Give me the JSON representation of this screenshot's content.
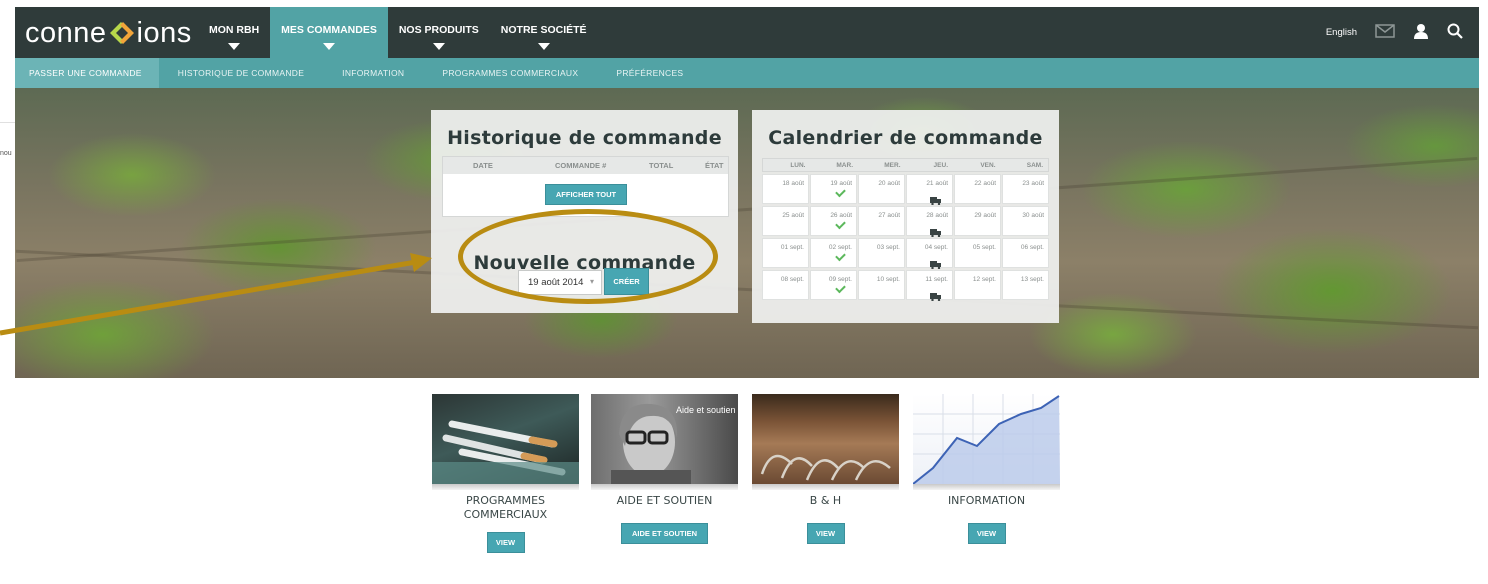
{
  "brand": {
    "logo_left": "conne",
    "logo_right": "ions",
    "logo_mark": "X"
  },
  "nav": {
    "items": [
      {
        "label": "MON RBH",
        "active": false
      },
      {
        "label": "MES COMMANDES",
        "active": true
      },
      {
        "label": "NOS PRODUITS",
        "active": false
      },
      {
        "label": "NOTRE SOCIÉTÉ",
        "active": false
      }
    ],
    "lang": "English",
    "icons": [
      "mail-icon",
      "user-icon",
      "search-icon"
    ]
  },
  "subnav": {
    "items": [
      {
        "label": "PASSER UNE COMMANDE",
        "active": true
      },
      {
        "label": "HISTORIQUE DE COMMANDE",
        "active": false
      },
      {
        "label": "INFORMATION",
        "active": false
      },
      {
        "label": "PROGRAMMES COMMERCIAUX",
        "active": false
      },
      {
        "label": "PRÉFÉRENCES",
        "active": false
      }
    ]
  },
  "history": {
    "title": "Historique de commande",
    "columns": [
      "DATE",
      "COMMANDE #",
      "TOTAL",
      "ÉTAT"
    ],
    "show_all": "AFFICHER TOUT"
  },
  "new_order": {
    "title": "Nouvelle commande",
    "date_value": "19 août 2014",
    "create": "CRÉER"
  },
  "calendar": {
    "title": "Calendrier de commande",
    "days": [
      "LUN.",
      "MAR.",
      "MER.",
      "JEU.",
      "VEN.",
      "SAM."
    ],
    "weeks": [
      [
        "18 août",
        "19 août",
        "20 août",
        "21 août",
        "22 août",
        "23 août"
      ],
      [
        "25 août",
        "26 août",
        "27 août",
        "28 août",
        "29 août",
        "30 août"
      ],
      [
        "01 sept.",
        "02 sept.",
        "03 sept.",
        "04 sept.",
        "05 sept.",
        "06 sept."
      ],
      [
        "08 sept.",
        "09 sept.",
        "10 sept.",
        "11 sept.",
        "12 sept.",
        "13 sept."
      ]
    ],
    "check_column": 1,
    "truck_column": 3
  },
  "side_cut_text": "nou",
  "tiles": [
    {
      "title": "PROGRAMMES COMMERCIAUX",
      "button": "VIEW"
    },
    {
      "title": "AIDE ET SOUTIEN",
      "button": "AIDE ET SOUTIEN",
      "overlay": "Aide et soutien"
    },
    {
      "title": "B & H",
      "button": "VIEW"
    },
    {
      "title": "INFORMATION",
      "button": "VIEW"
    }
  ],
  "colors": {
    "header": "#2f3b3a",
    "accent": "#52a3a5",
    "button": "#47a6b2",
    "annotation": "#b98c12"
  }
}
